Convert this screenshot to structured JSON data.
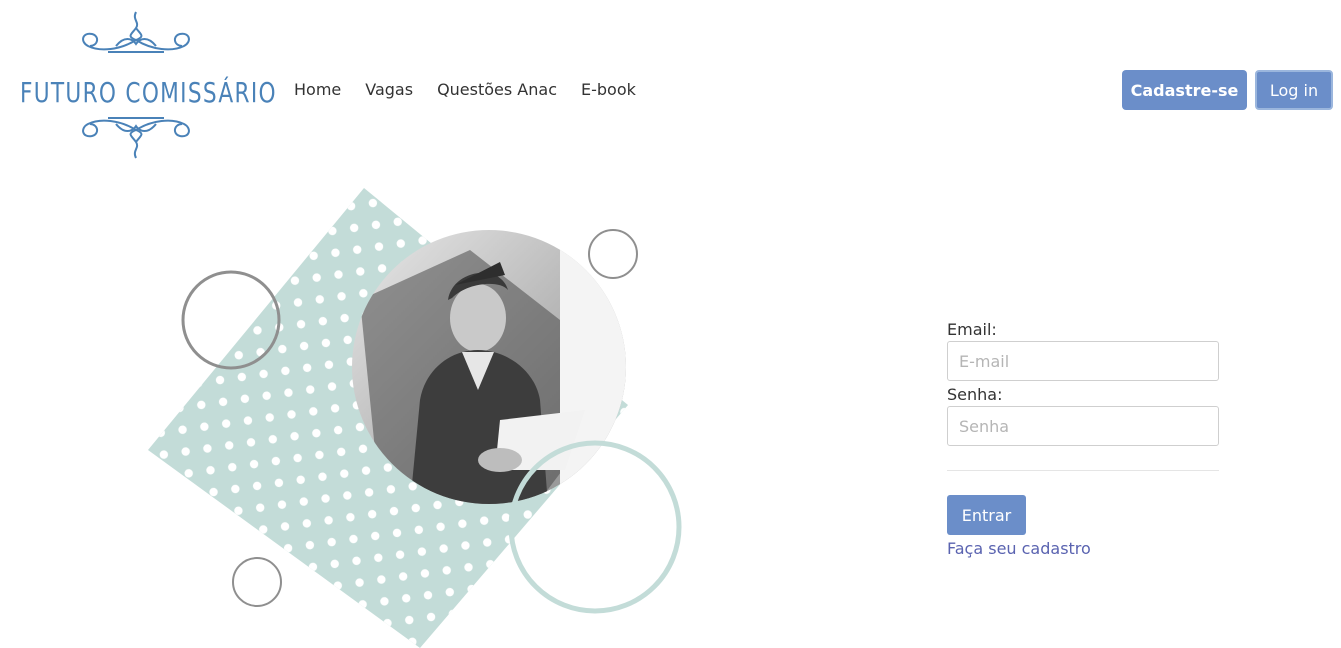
{
  "header": {
    "logo_text": "FUTURO COMISSÁRIO",
    "nav": [
      {
        "label": "Home"
      },
      {
        "label": "Vagas"
      },
      {
        "label": "Questões Anac"
      },
      {
        "label": "E-book"
      }
    ],
    "signup_label": "Cadastre-se",
    "login_label": "Log in"
  },
  "form": {
    "email_label": "Email:",
    "email_placeholder": "E-mail",
    "email_value": "",
    "password_label": "Senha:",
    "password_placeholder": "Senha",
    "password_value": "",
    "submit_label": "Entrar",
    "register_link": "Faça seu cadastro"
  },
  "colors": {
    "accent": "#6b8ec9",
    "logo": "#4a82b8",
    "mint": "#c3dcd8",
    "link": "#5a63b0"
  }
}
